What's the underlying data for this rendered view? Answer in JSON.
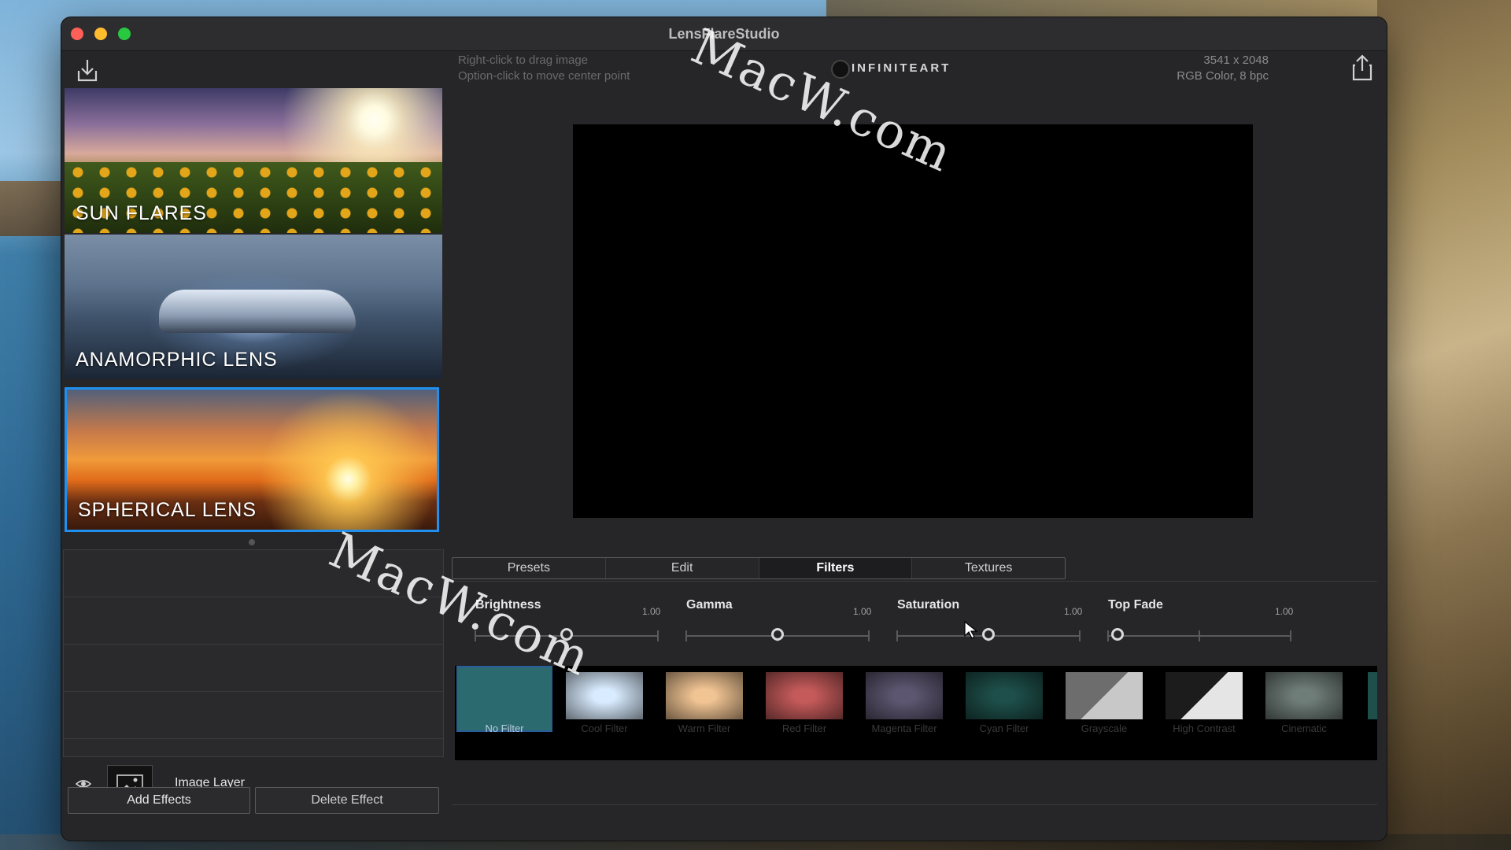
{
  "window": {
    "title": "LensFlareStudio"
  },
  "presets": [
    {
      "label": "SUN FLARES"
    },
    {
      "label": "ANAMORPHIC LENS"
    },
    {
      "label": "SPHERICAL LENS"
    }
  ],
  "canvas_info": {
    "hint_1": "Right-click to drag image",
    "hint_2": "Option-click to move center point",
    "brand": "INFINITEART",
    "dimensions": "3541 x 2048",
    "color_mode": "RGB Color, 8 bpc"
  },
  "tabs": [
    {
      "label": "Presets"
    },
    {
      "label": "Edit"
    },
    {
      "label": "Filters"
    },
    {
      "label": "Textures"
    }
  ],
  "active_tab": "Filters",
  "sliders": [
    {
      "label": "Brightness",
      "value": "1.00",
      "level": 0.5
    },
    {
      "label": "Gamma",
      "value": "1.00",
      "level": 0.5
    },
    {
      "label": "Saturation",
      "value": "1.00",
      "level": 0.5
    },
    {
      "label": "Top Fade",
      "value": "1.00",
      "level": 0.05
    }
  ],
  "filters": [
    {
      "label": "No Filter",
      "color": "#2b6b70"
    },
    {
      "label": "Cool Filter",
      "color": "#d9ecff"
    },
    {
      "label": "Warm Filter",
      "color": "#f1c493"
    },
    {
      "label": "Red Filter",
      "color": "#c45a5a"
    },
    {
      "label": "Magenta Filter",
      "color": "#5d5670"
    },
    {
      "label": "Cyan Filter",
      "color": "#1e4f4a"
    },
    {
      "label": "Grayscale",
      "color": "#c8c8c8"
    },
    {
      "label": "High Contrast",
      "color": "#e5e5e5"
    },
    {
      "label": "Cinematic",
      "color": "#6f7d78"
    }
  ],
  "layer": {
    "name": "Image Layer"
  },
  "buttons": {
    "add": "Add Effects",
    "delete": "Delete Effect"
  },
  "watermark": "MacW.com"
}
